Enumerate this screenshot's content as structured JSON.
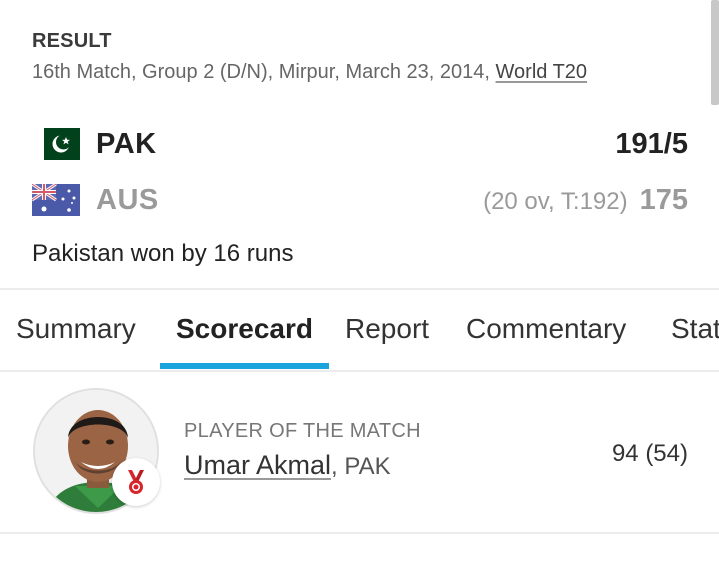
{
  "header": {
    "result_label": "RESULT",
    "match_info": "16th Match, Group 2 (D/N), Mirpur, March 23, 2014, ",
    "series_link": "World T20"
  },
  "teams": [
    {
      "code": "PAK",
      "overs": "",
      "score": "191/5",
      "flag_icon": "pakistan-flag-icon"
    },
    {
      "code": "AUS",
      "overs": "(20 ov, T:192)",
      "score": "175",
      "flag_icon": "australia-flag-icon"
    }
  ],
  "result_text": "Pakistan won by 16 runs",
  "tabs": [
    {
      "label": "Summary",
      "active": false
    },
    {
      "label": "Scorecard",
      "active": true
    },
    {
      "label": "Report",
      "active": false
    },
    {
      "label": "Commentary",
      "active": false
    },
    {
      "label": "Stats",
      "active": false
    }
  ],
  "potm": {
    "label": "PLAYER OF THE MATCH",
    "name": "Umar Akmal",
    "team": ", PAK",
    "score": "94 (54)"
  },
  "colors": {
    "accent": "#1ba3dd",
    "pak_green": "#01411c",
    "medal_red": "#d6262b"
  }
}
